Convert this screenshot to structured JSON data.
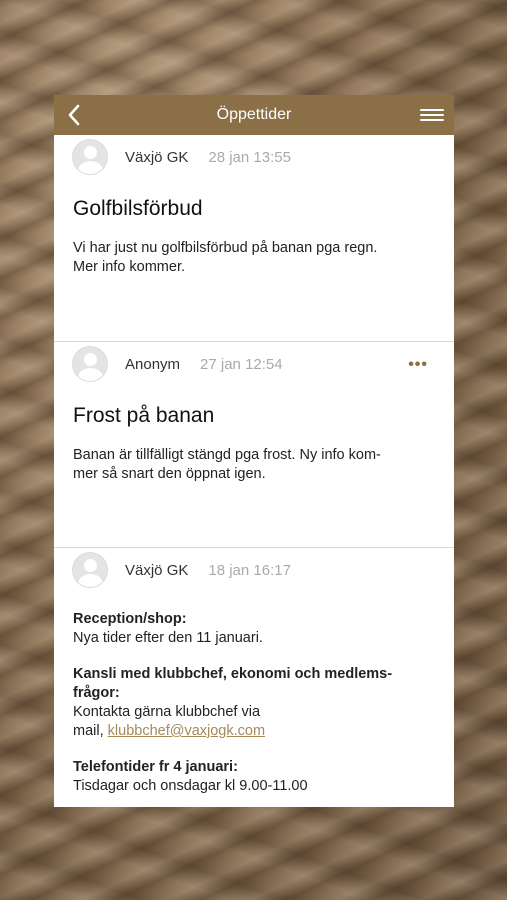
{
  "header": {
    "title": "Öppettider"
  },
  "posts": [
    {
      "author": "Växjö GK",
      "date": "28 jan 13:55",
      "title": "Golfbilsförbud",
      "body_line1": "Vi har just nu golfbilsförbud på banan pga regn.",
      "body_line2": "Mer info kommer."
    },
    {
      "author": "Anonym",
      "date": "27 jan 12:54",
      "more": "•••",
      "title": "Frost på banan",
      "body_line1": "Banan är tillfälligt stängd pga frost. Ny info kom-",
      "body_line2": "mer så snart den öppnat igen."
    },
    {
      "author": "Växjö GK",
      "date": "18 jan 16:17",
      "sections": [
        {
          "heading": "Reception/shop:",
          "text": "Nya tider efter den 11 januari."
        },
        {
          "heading_line1": "Kansli med klubbchef, ekonomi och medlems-",
          "heading_line2": "frågor:",
          "text_line1": "Kontakta gärna klubbchef via",
          "text_prefix": "mail, ",
          "link": "klubbchef@vaxjogk.com"
        },
        {
          "heading": "Telefontider fr 4 januari:",
          "text": "Tisdagar och onsdagar kl 9.00-11.00"
        }
      ]
    }
  ],
  "colors": {
    "header": "#8b6f47",
    "accent": "#a58a5a"
  }
}
